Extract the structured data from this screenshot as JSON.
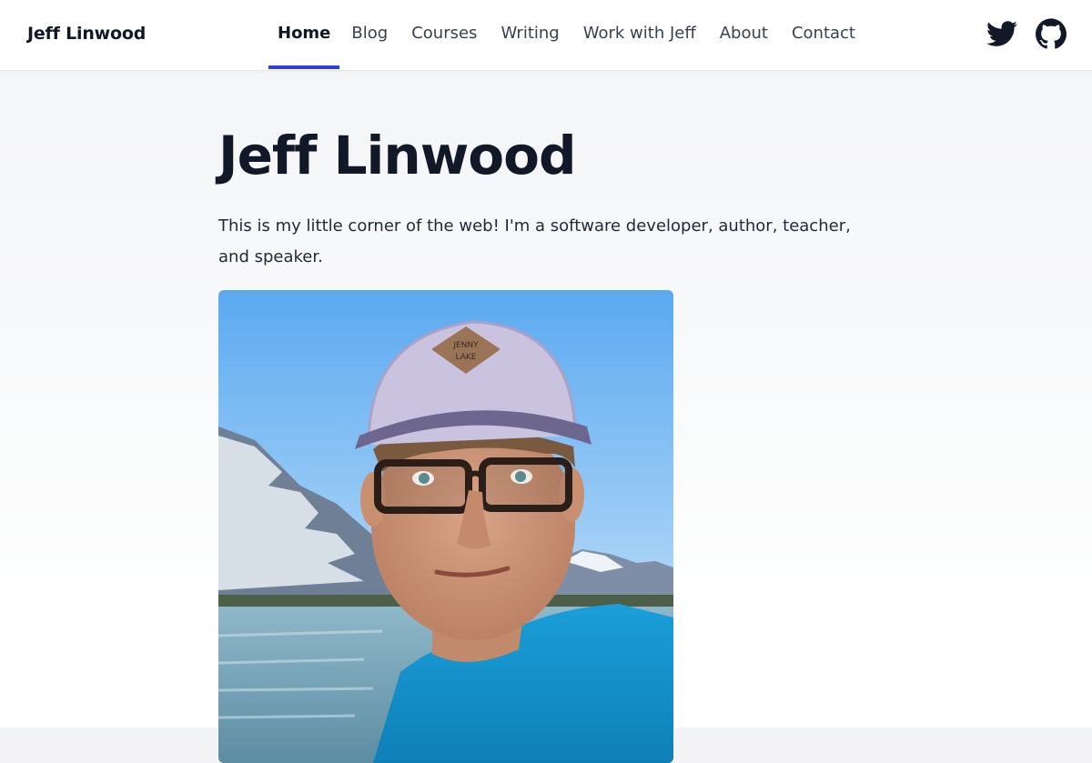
{
  "header": {
    "brand": "Jeff Linwood",
    "nav": [
      {
        "label": "Home",
        "active": true
      },
      {
        "label": "Blog",
        "active": false
      },
      {
        "label": "Courses",
        "active": false
      },
      {
        "label": "Writing",
        "active": false
      },
      {
        "label": "Work with Jeff",
        "active": false
      },
      {
        "label": "About",
        "active": false
      },
      {
        "label": "Contact",
        "active": false
      }
    ],
    "social": [
      {
        "icon": "twitter-icon"
      },
      {
        "icon": "github-icon"
      }
    ],
    "accent_color": "#2f3ee0"
  },
  "main": {
    "title": "Jeff Linwood",
    "intro": "This is my little corner of the web! I'm a software developer, author, teacher, and speaker.",
    "photo": {
      "cap_patch_line1": "JENNY",
      "cap_patch_line2": "LAKE"
    }
  }
}
